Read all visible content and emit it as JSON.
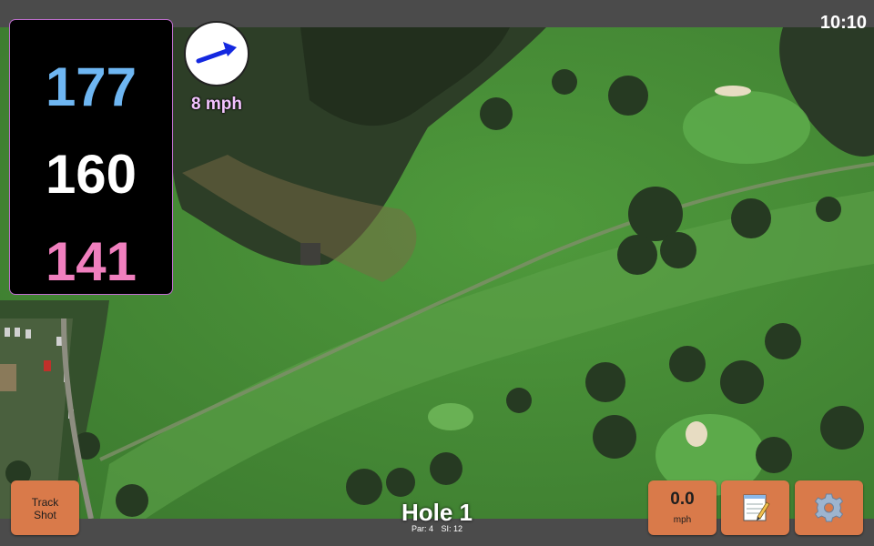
{
  "status_bar": {
    "time": "10:10"
  },
  "distances": {
    "back": "177",
    "middle": "160",
    "front": "141"
  },
  "wind": {
    "speed": "8 mph",
    "direction_icon": "arrow-right-icon"
  },
  "hole": {
    "title": "Hole 1",
    "par": "Par: 4",
    "si": "SI: 12"
  },
  "buttons": {
    "track_shot_line1": "Track",
    "track_shot_line2": "Shot",
    "speed_value": "0.0",
    "speed_unit": "mph",
    "notes_icon": "notepad-icon",
    "settings_icon": "gear-icon"
  },
  "colors": {
    "back_distance": "#6eb6f2",
    "middle_distance": "#ffffff",
    "front_distance": "#f07fbe",
    "button": "#d97a4a",
    "wind_text": "#f3c3ff"
  }
}
